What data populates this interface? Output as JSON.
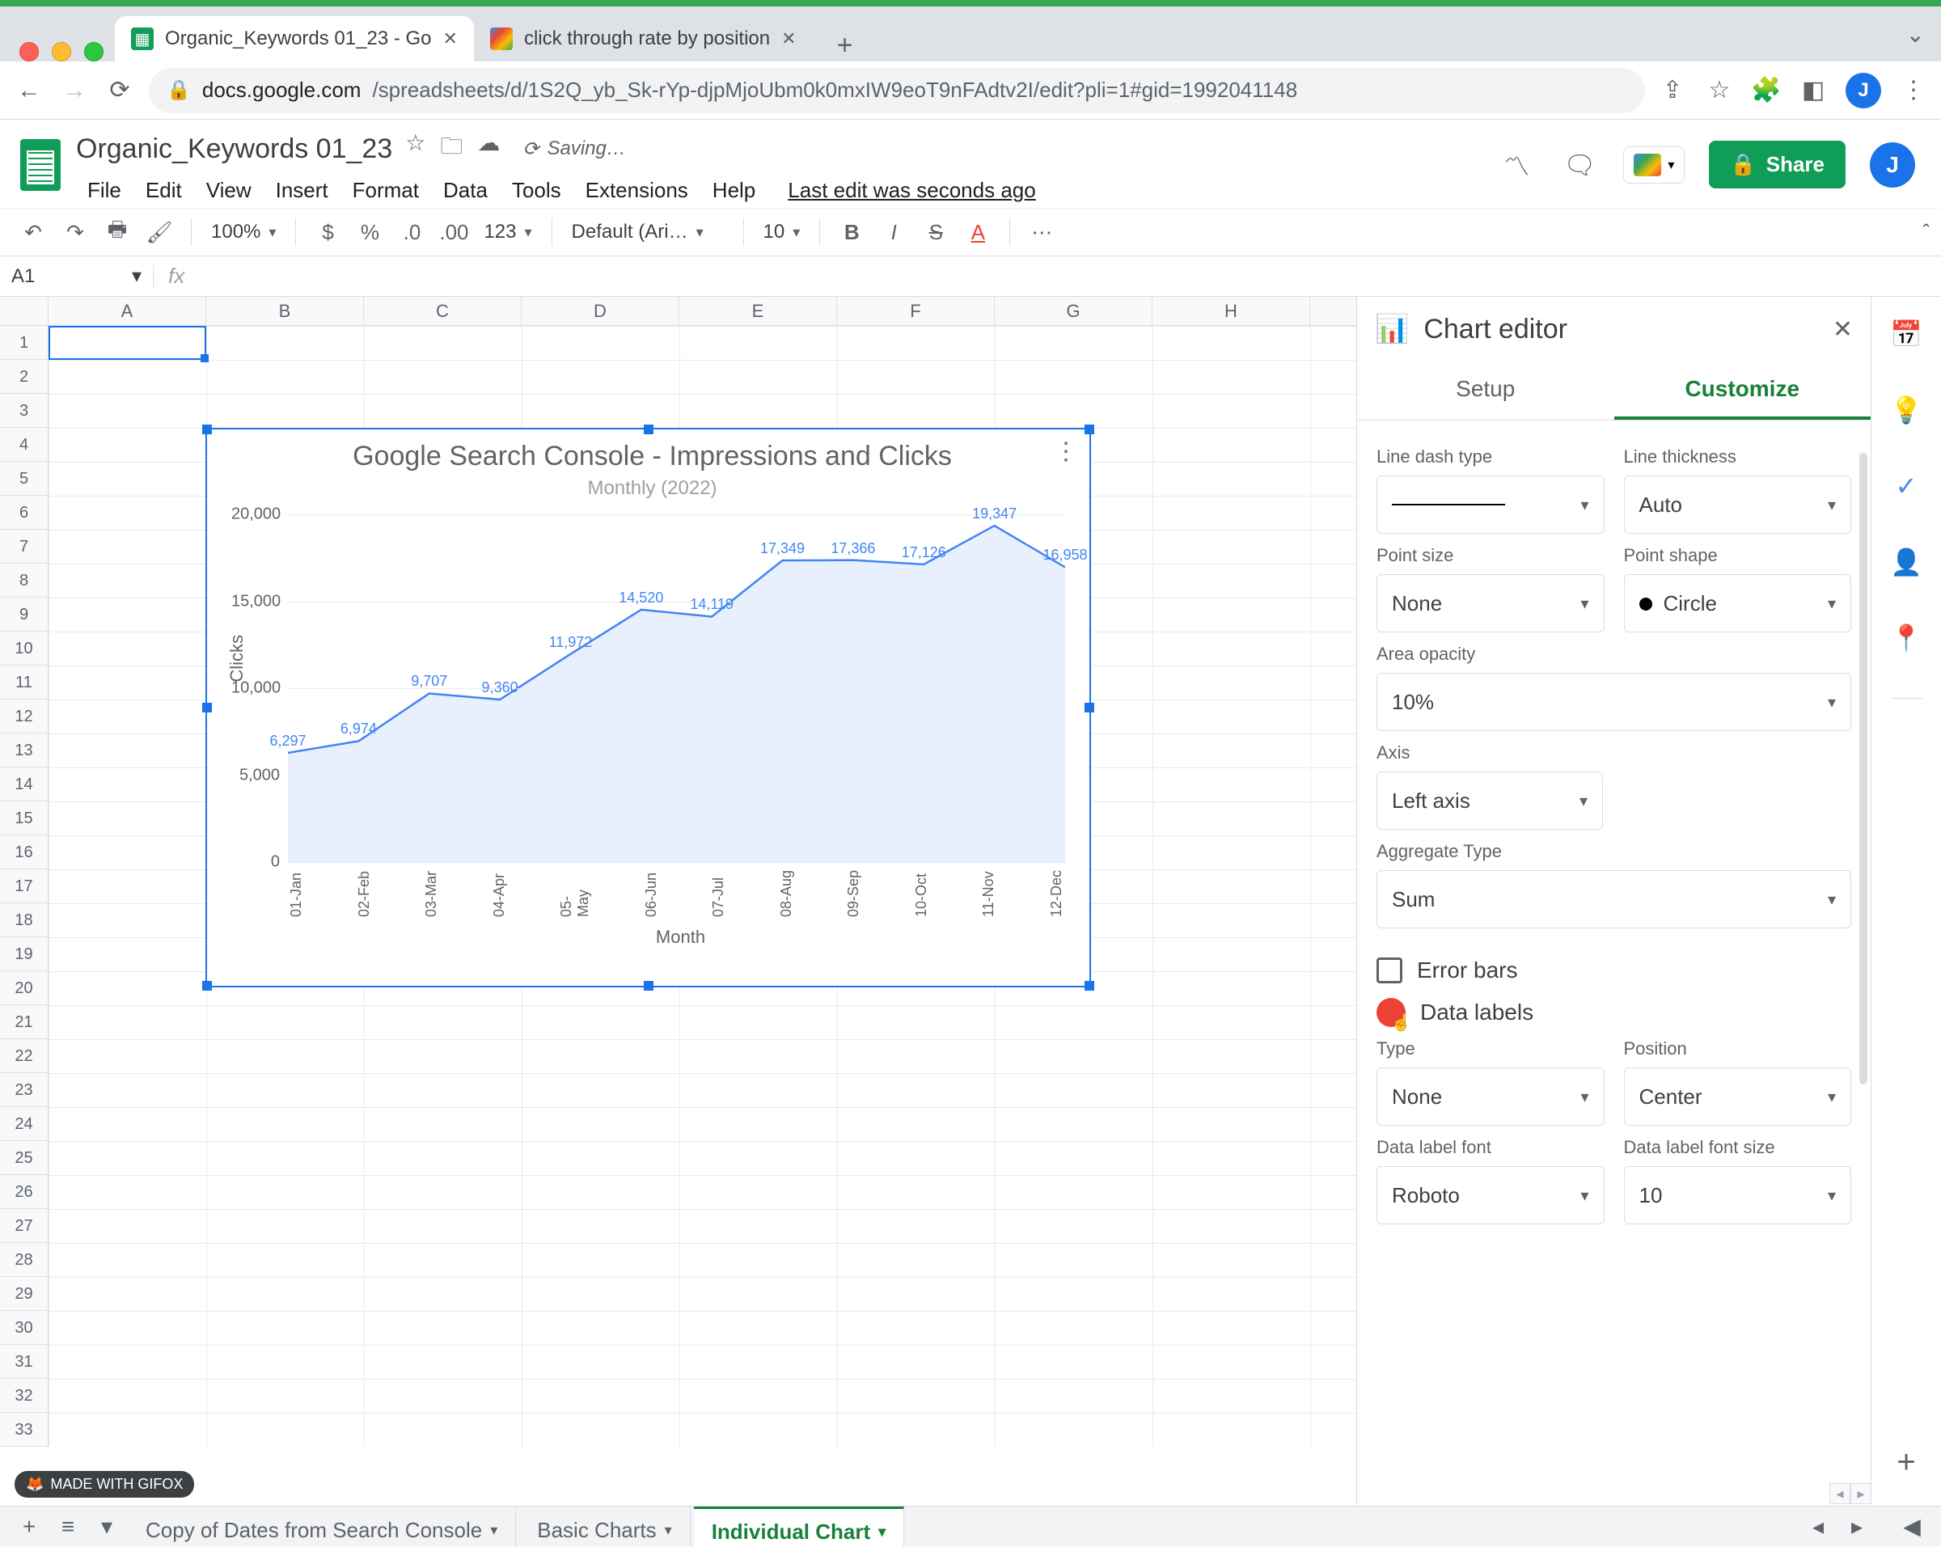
{
  "browser": {
    "tabs": [
      {
        "title": "Organic_Keywords 01_23 - Go",
        "active": true
      },
      {
        "title": "click through rate by position",
        "active": false
      }
    ],
    "url_host": "docs.google.com",
    "url_path": "/spreadsheets/d/1S2Q_yb_Sk-rYp-djpMjoUbm0k0mxIW9eoT9nFAdtv2I/edit?pli=1#gid=1992041148",
    "profile_initial": "J"
  },
  "sheets": {
    "doc_title": "Organic_Keywords 01_23",
    "saving": "Saving…",
    "menus": [
      "File",
      "Edit",
      "View",
      "Insert",
      "Format",
      "Data",
      "Tools",
      "Extensions",
      "Help"
    ],
    "last_edit": "Last edit was seconds ago",
    "share": "Share",
    "avatar_initial": "J"
  },
  "toolbar": {
    "zoom": "100%",
    "currency": "$",
    "percent": "%",
    "dec_less": ".0",
    "dec_more": ".00",
    "num_format": "123",
    "font": "Default (Ari…",
    "font_size": "10"
  },
  "namebox": "A1",
  "columns": [
    "A",
    "B",
    "C",
    "D",
    "E",
    "F",
    "G",
    "H"
  ],
  "rows_count": 33,
  "chart_data": {
    "type": "area",
    "title": "Google Search Console - Impressions and Clicks",
    "subtitle": "Monthly (2022)",
    "xlabel": "Month",
    "ylabel": "Clicks",
    "yticks": [
      0,
      5000,
      10000,
      15000,
      20000
    ],
    "ylim": [
      0,
      20000
    ],
    "categories": [
      "01-Jan",
      "02-Feb",
      "03-Mar",
      "04-Apr",
      "05-May",
      "06-Jun",
      "07-Jul",
      "08-Aug",
      "09-Sep",
      "10-Oct",
      "11-Nov",
      "12-Dec"
    ],
    "values": [
      6297,
      6974,
      9707,
      9360,
      11972,
      14520,
      14119,
      17349,
      17366,
      17126,
      19347,
      16958
    ]
  },
  "chart_editor": {
    "title": "Chart editor",
    "tabs": {
      "setup": "Setup",
      "customize": "Customize"
    },
    "fields": {
      "line_dash_type": {
        "label": "Line dash type"
      },
      "line_thickness": {
        "label": "Line thickness",
        "value": "Auto"
      },
      "point_size": {
        "label": "Point size",
        "value": "None"
      },
      "point_shape": {
        "label": "Point shape",
        "value": "Circle"
      },
      "area_opacity": {
        "label": "Area opacity",
        "value": "10%"
      },
      "axis": {
        "label": "Axis",
        "value": "Left axis"
      },
      "aggregate_type": {
        "label": "Aggregate Type",
        "value": "Sum"
      },
      "error_bars": {
        "label": "Error bars",
        "checked": false
      },
      "data_labels": {
        "label": "Data labels",
        "checked": true
      },
      "type": {
        "label": "Type",
        "value": "None"
      },
      "position": {
        "label": "Position",
        "value": "Center"
      },
      "data_label_font": {
        "label": "Data label font",
        "value": "Roboto"
      },
      "data_label_font_size": {
        "label": "Data label font size",
        "value": "10"
      }
    }
  },
  "sheet_tabs": {
    "items": [
      {
        "label": "Copy of Dates from Search Console",
        "active": false
      },
      {
        "label": "Basic Charts",
        "active": false
      },
      {
        "label": "Individual Chart",
        "active": true
      }
    ]
  },
  "gifox": "MADE WITH GIFOX"
}
